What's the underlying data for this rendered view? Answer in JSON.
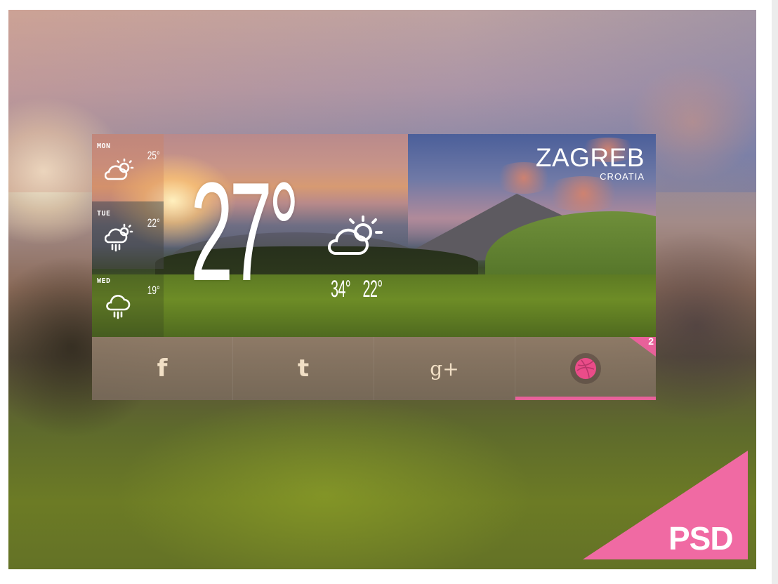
{
  "weather": {
    "city": "ZAGREB",
    "country": "CROATIA",
    "current_temp": "27°",
    "current_icon": "partly-sunny-icon",
    "high": "34°",
    "low": "22°"
  },
  "forecast": [
    {
      "day": "MON",
      "temp": "25°",
      "icon": "partly-sunny-icon"
    },
    {
      "day": "TUE",
      "temp": "22°",
      "icon": "sun-rain-icon"
    },
    {
      "day": "WED",
      "temp": "19°",
      "icon": "rain-cloud-icon"
    }
  ],
  "social": {
    "facebook": "f",
    "twitter": "t",
    "googleplus": "g+",
    "dribbble_icon": "dribbble-icon",
    "notification_count": "2"
  },
  "badge": {
    "label": "PSD"
  },
  "colors": {
    "accent": "#e8619a",
    "psd_corner": "#f06aa3"
  }
}
